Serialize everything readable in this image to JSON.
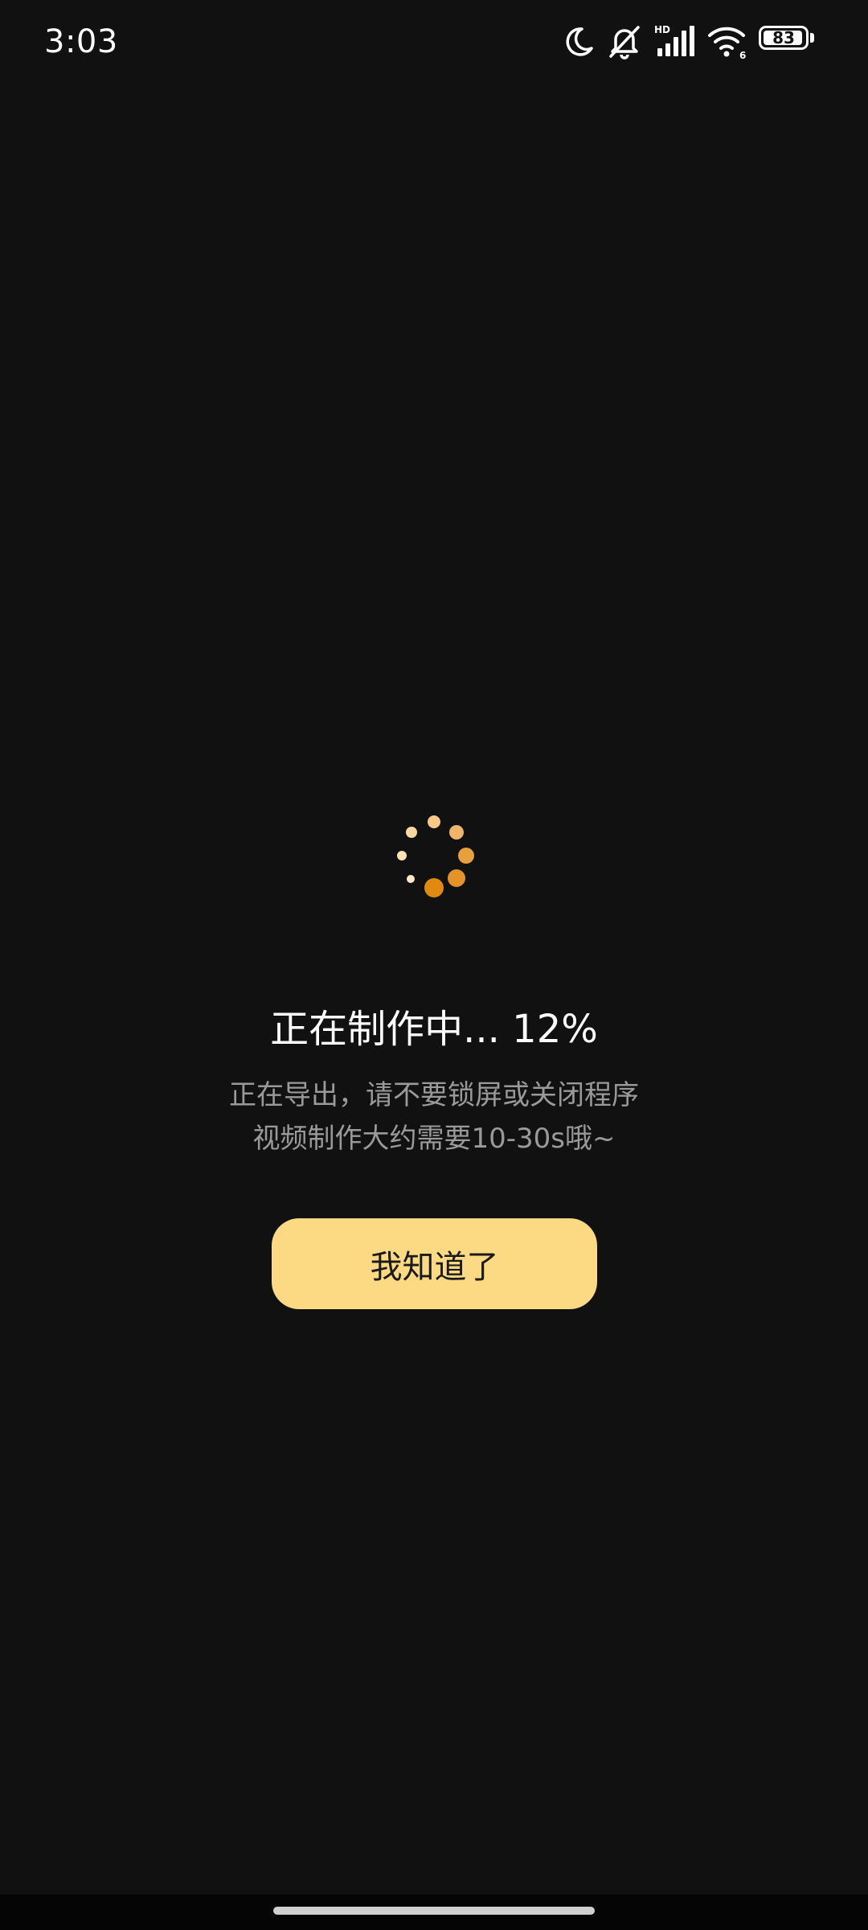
{
  "status_bar": {
    "time": "3:03",
    "battery_level": "83",
    "icons": [
      "moon-icon",
      "bell-off-icon",
      "hd-signal-icon",
      "wifi-icon",
      "battery-icon"
    ],
    "signal_label": "HD",
    "wifi_label": "6"
  },
  "progress": {
    "title": "正在制作中... 12%",
    "percent": 12,
    "subtitle_line1": "正在导出，请不要锁屏或关闭程序",
    "subtitle_line2": "视频制作大约需要10-30s哦~",
    "spinner_icon": "loading-spinner-icon"
  },
  "actions": {
    "ok_label": "我知道了"
  },
  "colors": {
    "background": "#111111",
    "accent": "#fcd983",
    "spinner_dark": "#e08a10",
    "spinner_light": "#fbe2b8",
    "subtitle": "#9a9a9a"
  }
}
